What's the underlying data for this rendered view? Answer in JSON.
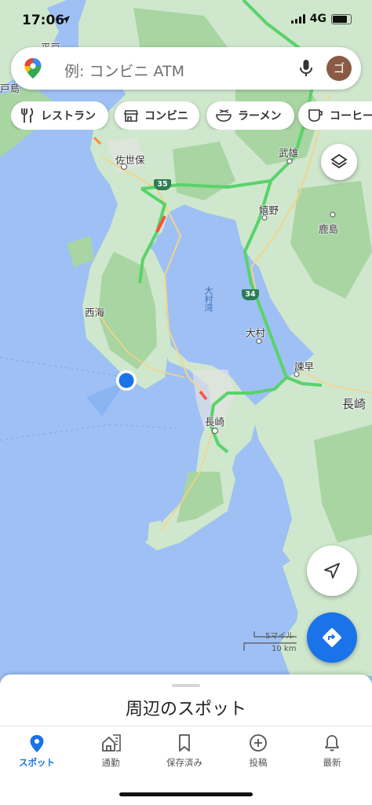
{
  "status_bar": {
    "time": "17:06",
    "network": "4G"
  },
  "search": {
    "placeholder": "例: コンビニ ATM",
    "avatar_initial": "ゴ"
  },
  "chips": [
    {
      "label": "レストラン",
      "icon": "fork-knife-icon"
    },
    {
      "label": "コンビニ",
      "icon": "store-icon"
    },
    {
      "label": "ラーメン",
      "icon": "ramen-bowl-icon"
    },
    {
      "label": "コーヒー",
      "icon": "coffee-cup-icon"
    }
  ],
  "map": {
    "place_labels": [
      "平戸",
      "戸島",
      "佐世保",
      "武雄",
      "嬉野",
      "鹿島",
      "西海",
      "大村",
      "諫早",
      "長崎",
      "長崎"
    ],
    "water_labels": [
      "大村湾"
    ],
    "route_shields": [
      "35",
      "34"
    ],
    "scale": {
      "imperial": "5マイル",
      "metric": "10 km"
    },
    "colors": {
      "sea": "#9ec0f4",
      "land": "#cfe7cd",
      "forest": "#a8d5a2",
      "highway": "#58d36a",
      "congestion": "#ff4e40",
      "location": "#1a73e8"
    }
  },
  "sheet": {
    "title": "周辺のスポット"
  },
  "nav": [
    {
      "label": "スポット",
      "icon": "location-pin-icon",
      "active": true
    },
    {
      "label": "通勤",
      "icon": "commute-icon",
      "active": false
    },
    {
      "label": "保存済み",
      "icon": "bookmark-icon",
      "active": false
    },
    {
      "label": "投稿",
      "icon": "add-circle-icon",
      "active": false
    },
    {
      "label": "最新",
      "icon": "bell-icon",
      "active": false
    }
  ]
}
